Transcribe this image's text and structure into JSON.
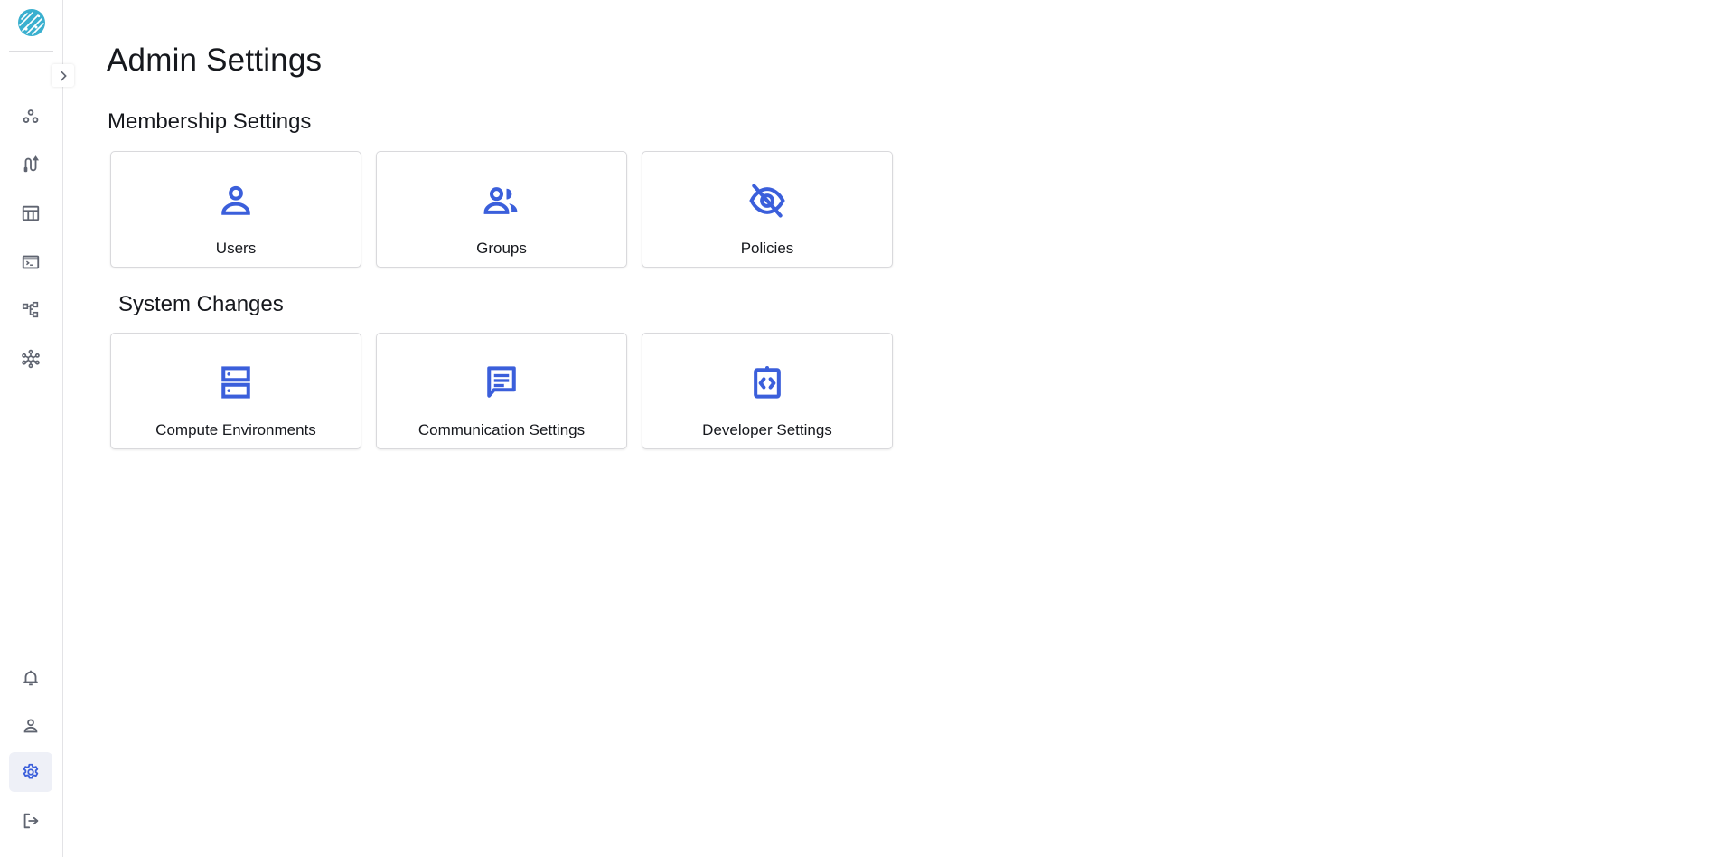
{
  "sidebar": {
    "logo": "app-logo",
    "toggle_icon": "chevron-right-icon",
    "top_items": [
      {
        "name": "projects",
        "icon": "three-circles-icon"
      },
      {
        "name": "pipelines",
        "icon": "route-icon"
      },
      {
        "name": "datasets",
        "icon": "table-icon"
      },
      {
        "name": "terminal",
        "icon": "terminal-icon"
      },
      {
        "name": "workflows",
        "icon": "hierarchy-icon"
      },
      {
        "name": "network",
        "icon": "network-icon"
      }
    ],
    "bottom_items": [
      {
        "name": "notifications",
        "icon": "bell-icon"
      },
      {
        "name": "profile",
        "icon": "person-icon"
      },
      {
        "name": "admin-settings",
        "icon": "gear-icon",
        "active": true
      },
      {
        "name": "logout",
        "icon": "logout-icon"
      }
    ]
  },
  "page": {
    "title": "Admin Settings"
  },
  "sections": [
    {
      "title": "Membership Settings",
      "cards": [
        {
          "label": "Users",
          "icon": "person-icon"
        },
        {
          "label": "Groups",
          "icon": "group-icon"
        },
        {
          "label": "Policies",
          "icon": "eye-off-icon"
        }
      ]
    },
    {
      "title": "System Changes",
      "cards": [
        {
          "label": "Compute Environments",
          "icon": "server-icon"
        },
        {
          "label": "Communication Settings",
          "icon": "message-icon"
        },
        {
          "label": "Developer Settings",
          "icon": "code-clipboard-icon"
        }
      ]
    }
  ],
  "colors": {
    "accent": "#3b5fdb",
    "sidebar_icon": "#5f6470",
    "logo": "#3bb0cf",
    "active_bg": "#eef0f7"
  }
}
